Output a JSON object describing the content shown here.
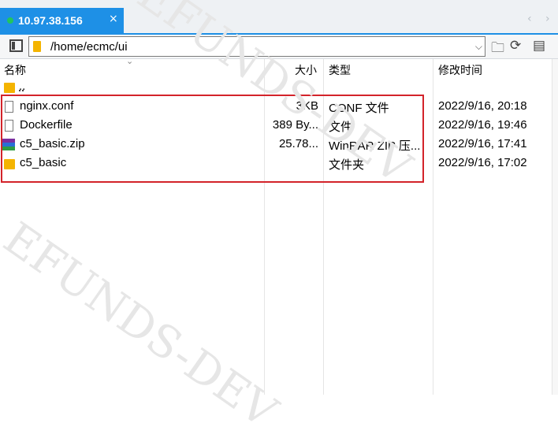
{
  "tab": {
    "title": "10.97.38.156",
    "close": "×",
    "prev_arrow": "‹",
    "next_arrow": "›"
  },
  "toolbar": {
    "path": "/home/ecmc/ui",
    "dropdown_glyph": "⌵",
    "newfolder_glyph": "🗀",
    "refresh_glyph": "⟳",
    "view_glyph": "▤"
  },
  "columns": {
    "name": "名称",
    "size": "大小",
    "type": "类型",
    "modified": "修改时间",
    "sort_caret": "⌄"
  },
  "parent_row": {
    "label": ".."
  },
  "files": [
    {
      "name": "nginx.conf",
      "size": "3KB",
      "type": "CONF 文件",
      "modified": "2022/9/16, 20:18",
      "icon": "file-icon"
    },
    {
      "name": "Dockerfile",
      "size": "389 By...",
      "type": "文件",
      "modified": "2022/9/16, 19:46",
      "icon": "file-icon"
    },
    {
      "name": "c5_basic.zip",
      "size": "25.78...",
      "type": "WinRAR ZIP 压...",
      "modified": "2022/9/16, 17:41",
      "icon": "winrar-zip-icon"
    },
    {
      "name": "c5_basic",
      "size": "",
      "type": "文件夹",
      "modified": "2022/9/16, 17:02",
      "icon": "folder-icon"
    }
  ],
  "watermark": "EFUNDS-DEV",
  "colors": {
    "tab_active": "#1e90e6",
    "connected_dot": "#22c55e",
    "highlight_border": "#d3232a",
    "folder": "#f4b400"
  }
}
